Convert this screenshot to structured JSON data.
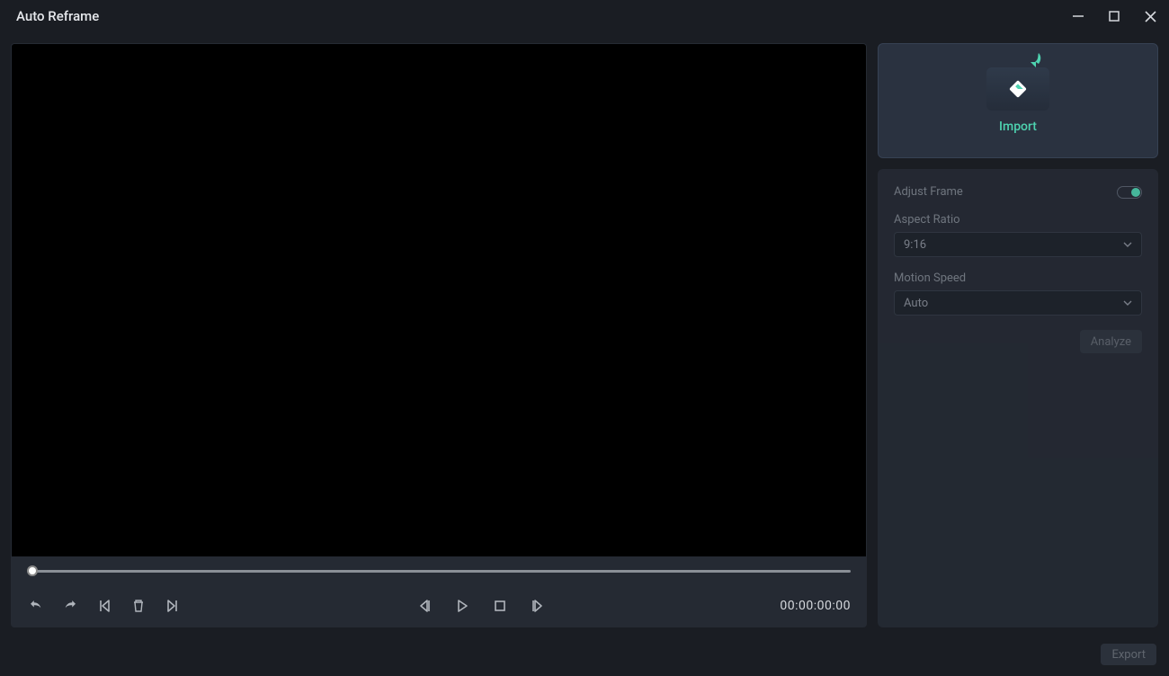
{
  "window": {
    "title": "Auto Reframe"
  },
  "import": {
    "label": "Import"
  },
  "settings": {
    "adjust_frame_label": "Adjust Frame",
    "aspect_ratio_label": "Aspect Ratio",
    "aspect_ratio_value": "9:16",
    "motion_speed_label": "Motion Speed",
    "motion_speed_value": "Auto",
    "analyze_label": "Analyze"
  },
  "player": {
    "timecode": "00:00:00:00"
  },
  "footer": {
    "export_label": "Export"
  }
}
